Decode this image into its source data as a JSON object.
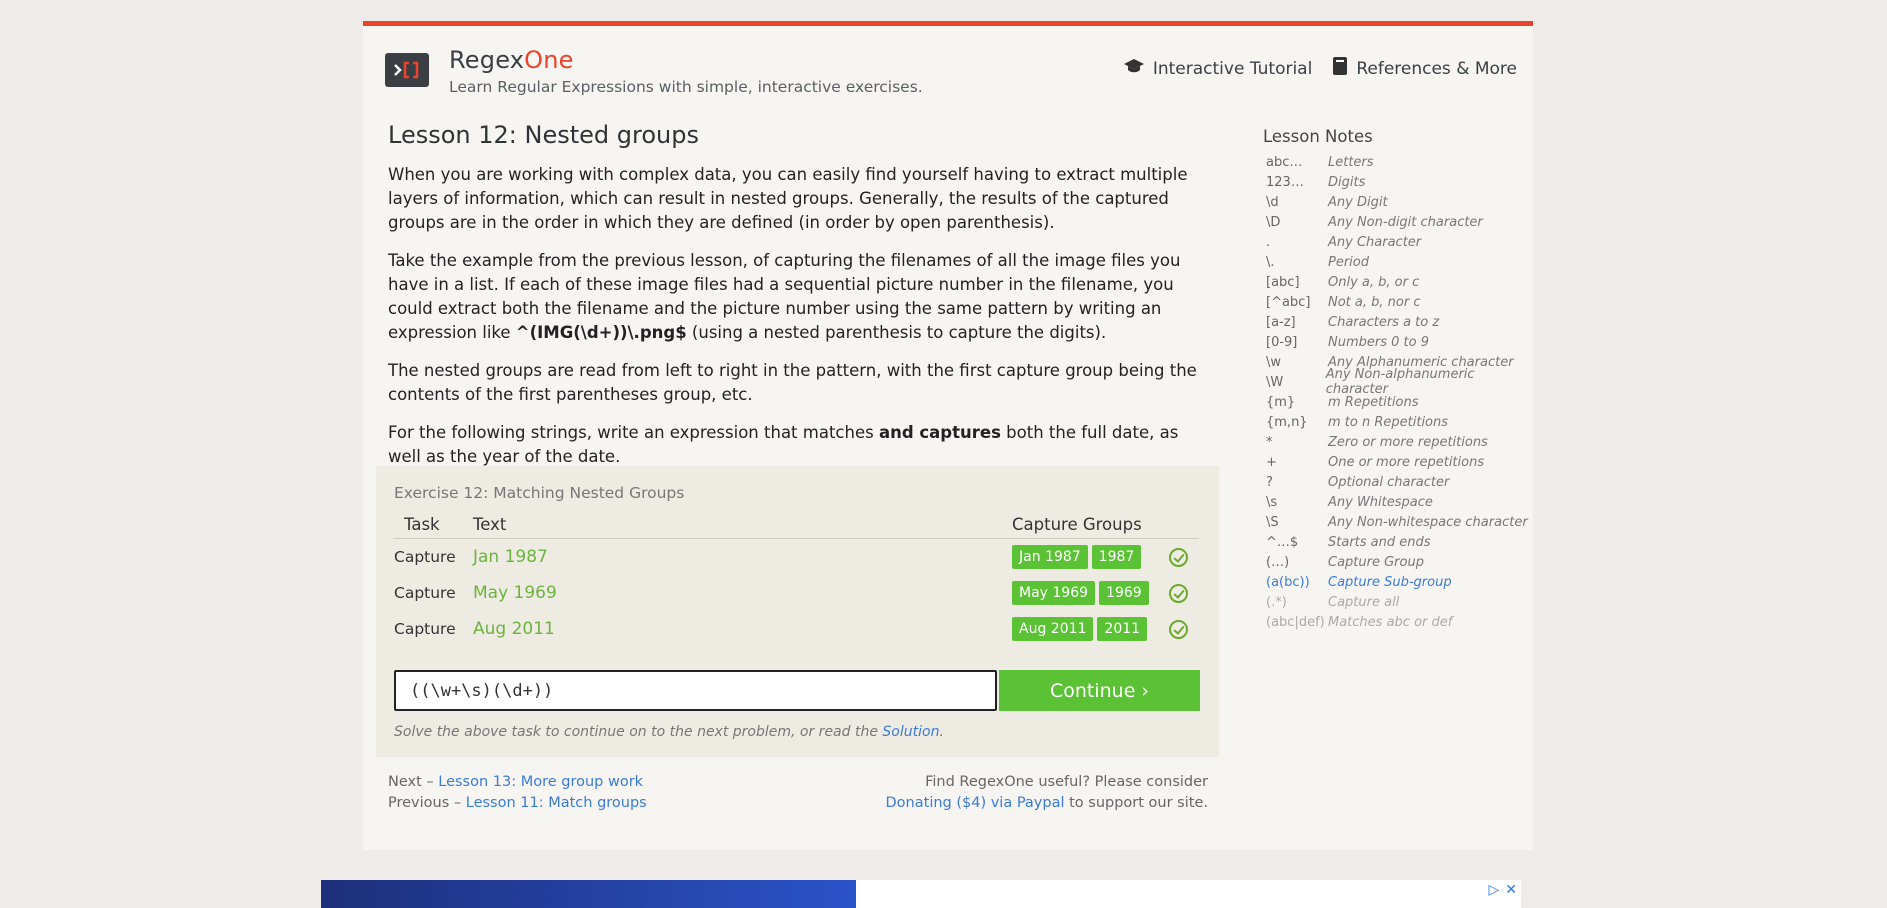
{
  "header": {
    "brand_part1": "Regex",
    "brand_part2": "One",
    "tagline": "Learn Regular Expressions with simple, interactive exercises.",
    "nav": [
      {
        "label": "Interactive Tutorial",
        "icon": "graduation-cap-icon"
      },
      {
        "label": "References & More",
        "icon": "book-icon"
      }
    ]
  },
  "lesson": {
    "title": "Lesson 12: Nested groups",
    "p1": "When you are working with complex data, you can easily find yourself having to extract multiple layers of information, which can result in nested groups. Generally, the results of the captured groups are in the order in which they are defined (in order by open parenthesis).",
    "p2_before": "Take the example from the previous lesson, of capturing the filenames of all the image files you have in a list. If each of these image files had a sequential picture number in the filename, you could extract both the filename and the picture number using the same pattern by writing an expression like ",
    "p2_code": "^(IMG(\\d+))\\.png$",
    "p2_after": " (using a nested parenthesis to capture the digits).",
    "p3": "The nested groups are read from left to right in the pattern, with the first capture group being the contents of the first parentheses group, etc.",
    "p4_before": "For the following strings, write an expression that matches ",
    "p4_bold": "and captures",
    "p4_after": " both the full date, as well as the year of the date."
  },
  "exercise": {
    "title": "Exercise 12: Matching Nested Groups",
    "headers": {
      "task": "Task",
      "text": "Text",
      "groups": "Capture Groups"
    },
    "rows": [
      {
        "task": "Capture",
        "text": "Jan 1987",
        "groups": [
          "Jan 1987",
          "1987"
        ]
      },
      {
        "task": "Capture",
        "text": "May 1969",
        "groups": [
          "May 1969",
          "1969"
        ]
      },
      {
        "task": "Capture",
        "text": "Aug 2011",
        "groups": [
          "Aug 2011",
          "2011"
        ]
      }
    ],
    "input_value": "((\\w+\\s)(\\d+))",
    "continue_label": "Continue ›",
    "hint_before": "Solve the above task to continue on to the next problem, or read the ",
    "hint_link": "Solution",
    "hint_after": "."
  },
  "footer": {
    "next_prefix": "Next – ",
    "next_link": "Lesson 13: More group work",
    "prev_prefix": "Previous – ",
    "prev_link": "Lesson 11: Match groups",
    "support_line": "Find RegexOne useful? Please consider",
    "donate_link": "Donating ($4) via Paypal",
    "support_after": " to support our site."
  },
  "notes": {
    "title": "Lesson Notes",
    "items": [
      {
        "sym": "abc…",
        "desc": "Letters"
      },
      {
        "sym": "123…",
        "desc": "Digits"
      },
      {
        "sym": "\\d",
        "desc": "Any Digit"
      },
      {
        "sym": "\\D",
        "desc": "Any Non-digit character"
      },
      {
        "sym": ".",
        "desc": "Any Character"
      },
      {
        "sym": "\\.",
        "desc": "Period"
      },
      {
        "sym": "[abc]",
        "desc": "Only a, b, or c"
      },
      {
        "sym": "[^abc]",
        "desc": "Not a, b, nor c"
      },
      {
        "sym": "[a-z]",
        "desc": "Characters a to z"
      },
      {
        "sym": "[0-9]",
        "desc": "Numbers 0 to 9"
      },
      {
        "sym": "\\w",
        "desc": "Any Alphanumeric character"
      },
      {
        "sym": "\\W",
        "desc": "Any Non-alphanumeric character"
      },
      {
        "sym": "{m}",
        "desc": "m Repetitions"
      },
      {
        "sym": "{m,n}",
        "desc": "m to n Repetitions"
      },
      {
        "sym": "*",
        "desc": "Zero or more repetitions"
      },
      {
        "sym": "+",
        "desc": "One or more repetitions"
      },
      {
        "sym": "?",
        "desc": "Optional character"
      },
      {
        "sym": "\\s",
        "desc": "Any Whitespace"
      },
      {
        "sym": "\\S",
        "desc": "Any Non-whitespace character"
      },
      {
        "sym": "^…$",
        "desc": "Starts and ends"
      },
      {
        "sym": "(…)",
        "desc": "Capture Group"
      },
      {
        "sym": "(a(bc))",
        "desc": "Capture Sub-group",
        "state": "active"
      },
      {
        "sym": "(.*)",
        "desc": "Capture all",
        "state": "dim"
      },
      {
        "sym": "(abc|def)",
        "desc": "Matches abc or def",
        "state": "dim"
      }
    ]
  },
  "colors": {
    "accent": "#e8452c",
    "success": "#5bc236",
    "link": "#3a7bd5"
  }
}
